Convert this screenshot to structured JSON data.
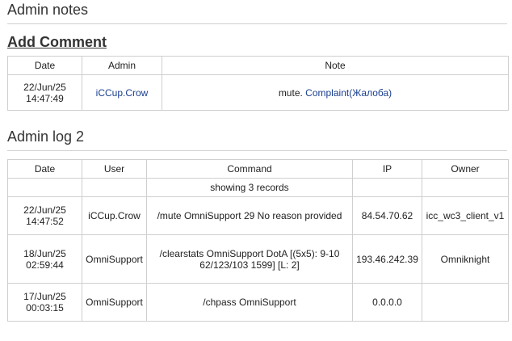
{
  "admin_notes": {
    "title": "Admin notes",
    "add_comment": "Add Comment",
    "columns": [
      "Date",
      "Admin",
      "Note"
    ],
    "rows": [
      {
        "date": "22/Jun/25",
        "time": "14:47:49",
        "admin": "iCCup.Crow",
        "note_prefix": "mute.",
        "note_link": "Complaint(Жалоба)"
      }
    ]
  },
  "admin_log": {
    "title": "Admin log 2",
    "columns": [
      "Date",
      "User",
      "Command",
      "IP",
      "Owner"
    ],
    "records_info": "showing 3 records",
    "rows": [
      {
        "date": "22/Jun/25",
        "time": "14:47:52",
        "user": "iCCup.Crow",
        "command": "/mute OmniSupport 29 No reason provided",
        "ip": "84.54.70.62",
        "owner": "icc_wc3_client_v1"
      },
      {
        "date": "18/Jun/25",
        "time": "02:59:44",
        "user": "OmniSupport",
        "command": "/clearstats OmniSupport DotA [(5x5): 9-10 62/123/103 1599] [L: 2]",
        "ip": "193.46.242.39",
        "owner": "Omniknight"
      },
      {
        "date": "17/Jun/25",
        "time": "00:03:15",
        "user": "OmniSupport",
        "command": "/chpass OmniSupport",
        "ip": "0.0.0.0",
        "owner": ""
      }
    ]
  },
  "colors": {
    "link": "#1a3f8f",
    "border": "#cfcfcf",
    "text": "#222222"
  }
}
